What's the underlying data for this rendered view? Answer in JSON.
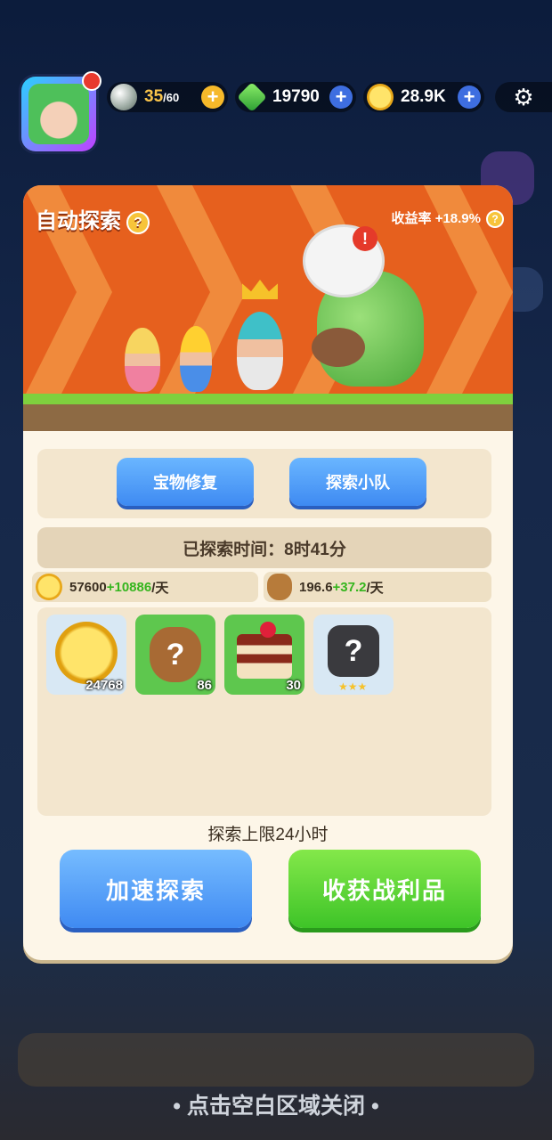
{
  "topbar": {
    "stamina": {
      "value": "35",
      "max": "/60"
    },
    "gems": {
      "value": "19790"
    },
    "coins": {
      "value": "28.9K"
    }
  },
  "panel": {
    "title": "自动探索",
    "yield_label": "收益率 +18.9%",
    "buttons": {
      "treasure_repair": "宝物修复",
      "explore_team": "探索小队"
    },
    "explored_time": "已探索时间：8时41分",
    "rates": {
      "coin_base": "57600",
      "coin_bonus": "+10886",
      "coin_unit": "/天",
      "bag_base": "196.6",
      "bag_bonus": "+37.2",
      "bag_unit": "/天"
    },
    "items": [
      {
        "icon": "coin-icon",
        "count": "24768"
      },
      {
        "icon": "mystery-bag-icon",
        "count": "86"
      },
      {
        "icon": "cake-icon",
        "count": "30"
      },
      {
        "icon": "mystery-armor-icon",
        "count": ""
      }
    ],
    "limit_text": "探索上限24小时",
    "speed_up_button": "加速探索",
    "harvest_button": "收获战利品"
  },
  "close_hint": "• 点击空白区域关闭 •"
}
